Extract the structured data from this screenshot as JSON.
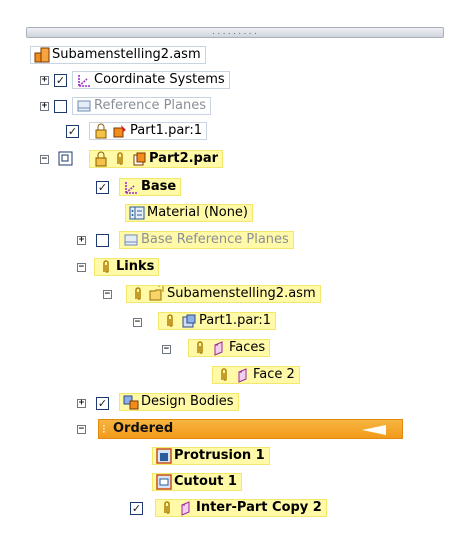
{
  "toolbar": {
    "grip": "........."
  },
  "tree": {
    "root": "Subamenstelling2.asm",
    "coordinate_systems": "Coordinate Systems",
    "reference_planes": "Reference Planes",
    "part1": "Part1.par:1",
    "part2": "Part2.par",
    "base": "Base",
    "material": "Material (None)",
    "base_reference_planes": "Base Reference Planes",
    "links": "Links",
    "link_asm": "Subamenstelling2.asm",
    "link_part1": "Part1.par:1",
    "faces": "Faces",
    "face2": "Face 2",
    "design_bodies": "Design Bodies",
    "ordered": "Ordered",
    "protrusion": "Protrusion 1",
    "cutout": "Cutout 1",
    "inter_part_copy": "Inter-Part Copy 2"
  },
  "expanders": {
    "plus": "+",
    "minus": "−"
  },
  "check": "✓",
  "colors": {
    "highlight": "#fff9a8",
    "ordered": "#f29a1b",
    "accent": "#1c3a6b"
  }
}
